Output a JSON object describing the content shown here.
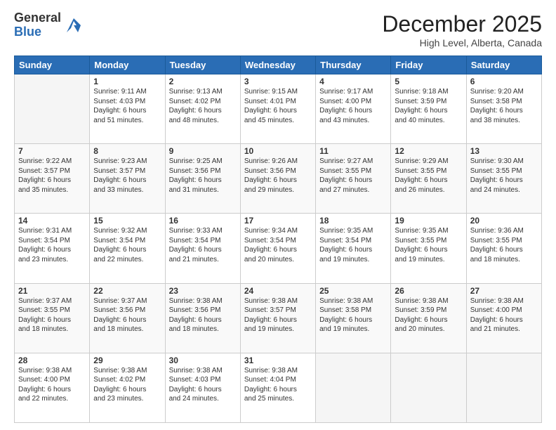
{
  "logo": {
    "general": "General",
    "blue": "Blue"
  },
  "header": {
    "month": "December 2025",
    "location": "High Level, Alberta, Canada"
  },
  "days_of_week": [
    "Sunday",
    "Monday",
    "Tuesday",
    "Wednesday",
    "Thursday",
    "Friday",
    "Saturday"
  ],
  "weeks": [
    [
      {
        "day": "",
        "info": ""
      },
      {
        "day": "1",
        "info": "Sunrise: 9:11 AM\nSunset: 4:03 PM\nDaylight: 6 hours\nand 51 minutes."
      },
      {
        "day": "2",
        "info": "Sunrise: 9:13 AM\nSunset: 4:02 PM\nDaylight: 6 hours\nand 48 minutes."
      },
      {
        "day": "3",
        "info": "Sunrise: 9:15 AM\nSunset: 4:01 PM\nDaylight: 6 hours\nand 45 minutes."
      },
      {
        "day": "4",
        "info": "Sunrise: 9:17 AM\nSunset: 4:00 PM\nDaylight: 6 hours\nand 43 minutes."
      },
      {
        "day": "5",
        "info": "Sunrise: 9:18 AM\nSunset: 3:59 PM\nDaylight: 6 hours\nand 40 minutes."
      },
      {
        "day": "6",
        "info": "Sunrise: 9:20 AM\nSunset: 3:58 PM\nDaylight: 6 hours\nand 38 minutes."
      }
    ],
    [
      {
        "day": "7",
        "info": "Sunrise: 9:22 AM\nSunset: 3:57 PM\nDaylight: 6 hours\nand 35 minutes."
      },
      {
        "day": "8",
        "info": "Sunrise: 9:23 AM\nSunset: 3:57 PM\nDaylight: 6 hours\nand 33 minutes."
      },
      {
        "day": "9",
        "info": "Sunrise: 9:25 AM\nSunset: 3:56 PM\nDaylight: 6 hours\nand 31 minutes."
      },
      {
        "day": "10",
        "info": "Sunrise: 9:26 AM\nSunset: 3:56 PM\nDaylight: 6 hours\nand 29 minutes."
      },
      {
        "day": "11",
        "info": "Sunrise: 9:27 AM\nSunset: 3:55 PM\nDaylight: 6 hours\nand 27 minutes."
      },
      {
        "day": "12",
        "info": "Sunrise: 9:29 AM\nSunset: 3:55 PM\nDaylight: 6 hours\nand 26 minutes."
      },
      {
        "day": "13",
        "info": "Sunrise: 9:30 AM\nSunset: 3:55 PM\nDaylight: 6 hours\nand 24 minutes."
      }
    ],
    [
      {
        "day": "14",
        "info": "Sunrise: 9:31 AM\nSunset: 3:54 PM\nDaylight: 6 hours\nand 23 minutes."
      },
      {
        "day": "15",
        "info": "Sunrise: 9:32 AM\nSunset: 3:54 PM\nDaylight: 6 hours\nand 22 minutes."
      },
      {
        "day": "16",
        "info": "Sunrise: 9:33 AM\nSunset: 3:54 PM\nDaylight: 6 hours\nand 21 minutes."
      },
      {
        "day": "17",
        "info": "Sunrise: 9:34 AM\nSunset: 3:54 PM\nDaylight: 6 hours\nand 20 minutes."
      },
      {
        "day": "18",
        "info": "Sunrise: 9:35 AM\nSunset: 3:54 PM\nDaylight: 6 hours\nand 19 minutes."
      },
      {
        "day": "19",
        "info": "Sunrise: 9:35 AM\nSunset: 3:55 PM\nDaylight: 6 hours\nand 19 minutes."
      },
      {
        "day": "20",
        "info": "Sunrise: 9:36 AM\nSunset: 3:55 PM\nDaylight: 6 hours\nand 18 minutes."
      }
    ],
    [
      {
        "day": "21",
        "info": "Sunrise: 9:37 AM\nSunset: 3:55 PM\nDaylight: 6 hours\nand 18 minutes."
      },
      {
        "day": "22",
        "info": "Sunrise: 9:37 AM\nSunset: 3:56 PM\nDaylight: 6 hours\nand 18 minutes."
      },
      {
        "day": "23",
        "info": "Sunrise: 9:38 AM\nSunset: 3:56 PM\nDaylight: 6 hours\nand 18 minutes."
      },
      {
        "day": "24",
        "info": "Sunrise: 9:38 AM\nSunset: 3:57 PM\nDaylight: 6 hours\nand 19 minutes."
      },
      {
        "day": "25",
        "info": "Sunrise: 9:38 AM\nSunset: 3:58 PM\nDaylight: 6 hours\nand 19 minutes."
      },
      {
        "day": "26",
        "info": "Sunrise: 9:38 AM\nSunset: 3:59 PM\nDaylight: 6 hours\nand 20 minutes."
      },
      {
        "day": "27",
        "info": "Sunrise: 9:38 AM\nSunset: 4:00 PM\nDaylight: 6 hours\nand 21 minutes."
      }
    ],
    [
      {
        "day": "28",
        "info": "Sunrise: 9:38 AM\nSunset: 4:00 PM\nDaylight: 6 hours\nand 22 minutes."
      },
      {
        "day": "29",
        "info": "Sunrise: 9:38 AM\nSunset: 4:02 PM\nDaylight: 6 hours\nand 23 minutes."
      },
      {
        "day": "30",
        "info": "Sunrise: 9:38 AM\nSunset: 4:03 PM\nDaylight: 6 hours\nand 24 minutes."
      },
      {
        "day": "31",
        "info": "Sunrise: 9:38 AM\nSunset: 4:04 PM\nDaylight: 6 hours\nand 25 minutes."
      },
      {
        "day": "",
        "info": ""
      },
      {
        "day": "",
        "info": ""
      },
      {
        "day": "",
        "info": ""
      }
    ]
  ]
}
